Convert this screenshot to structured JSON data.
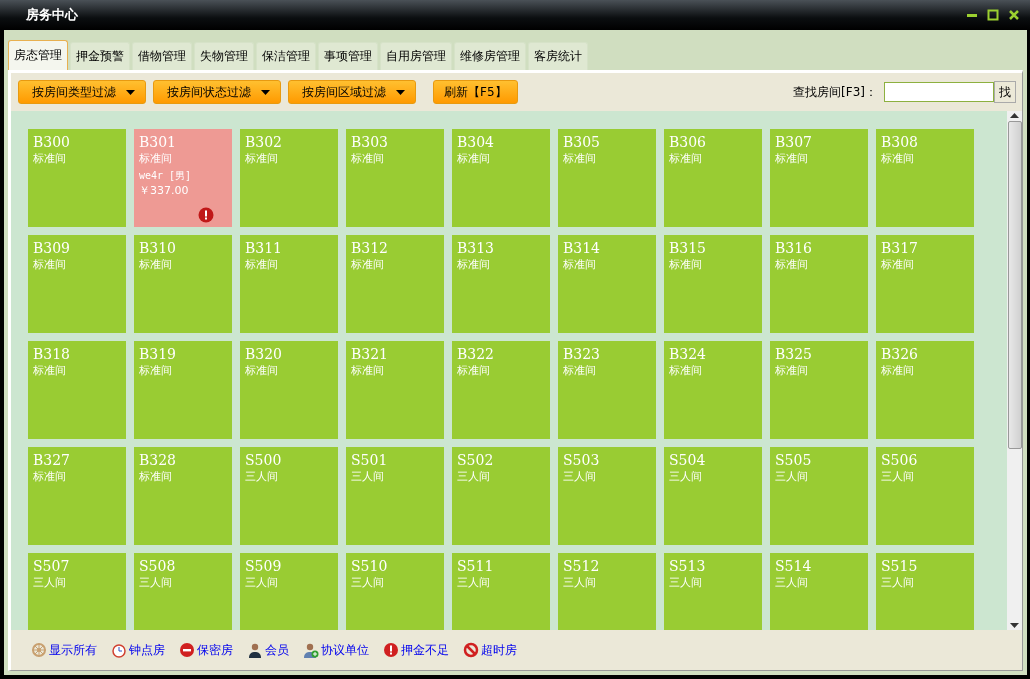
{
  "window": {
    "title": "房务中心"
  },
  "tabs": [
    {
      "label": "房态管理",
      "selected": true
    },
    {
      "label": "押金预警",
      "selected": false
    },
    {
      "label": "借物管理",
      "selected": false
    },
    {
      "label": "失物管理",
      "selected": false
    },
    {
      "label": "保洁管理",
      "selected": false
    },
    {
      "label": "事项管理",
      "selected": false
    },
    {
      "label": "自用房管理",
      "selected": false
    },
    {
      "label": "维修房管理",
      "selected": false
    },
    {
      "label": "客房统计",
      "selected": false
    }
  ],
  "filters": [
    "按房间类型过滤",
    "按房间状态过滤",
    "按房间区域过滤"
  ],
  "refresh_button": "刷新【F5】",
  "search": {
    "label": "查找房间[F3]：",
    "button": "找"
  },
  "rooms": [
    {
      "number": "B300",
      "type": "标准间",
      "color": "#99cc33"
    },
    {
      "number": "B301",
      "type": "标准间",
      "color": "#ee9a94",
      "guest": "we4r [男]",
      "price": "￥337.00",
      "alert": true
    },
    {
      "number": "B302",
      "type": "标准间",
      "color": "#99cc33"
    },
    {
      "number": "B303",
      "type": "标准间",
      "color": "#99cc33"
    },
    {
      "number": "B304",
      "type": "标准间",
      "color": "#99cc33"
    },
    {
      "number": "B305",
      "type": "标准间",
      "color": "#99cc33"
    },
    {
      "number": "B306",
      "type": "标准间",
      "color": "#99cc33"
    },
    {
      "number": "B307",
      "type": "标准间",
      "color": "#99cc33"
    },
    {
      "number": "B308",
      "type": "标准间",
      "color": "#99cc33"
    },
    {
      "number": "B309",
      "type": "标准间",
      "color": "#99cc33"
    },
    {
      "number": "B310",
      "type": "标准间",
      "color": "#99cc33"
    },
    {
      "number": "B311",
      "type": "标准间",
      "color": "#99cc33"
    },
    {
      "number": "B312",
      "type": "标准间",
      "color": "#99cc33"
    },
    {
      "number": "B313",
      "type": "标准间",
      "color": "#99cc33"
    },
    {
      "number": "B314",
      "type": "标准间",
      "color": "#99cc33"
    },
    {
      "number": "B315",
      "type": "标准间",
      "color": "#99cc33"
    },
    {
      "number": "B316",
      "type": "标准间",
      "color": "#99cc33"
    },
    {
      "number": "B317",
      "type": "标准间",
      "color": "#99cc33"
    },
    {
      "number": "B318",
      "type": "标准间",
      "color": "#99cc33"
    },
    {
      "number": "B319",
      "type": "标准间",
      "color": "#99cc33"
    },
    {
      "number": "B320",
      "type": "标准间",
      "color": "#99cc33"
    },
    {
      "number": "B321",
      "type": "标准间",
      "color": "#99cc33"
    },
    {
      "number": "B322",
      "type": "标准间",
      "color": "#99cc33"
    },
    {
      "number": "B323",
      "type": "标准间",
      "color": "#99cc33"
    },
    {
      "number": "B324",
      "type": "标准间",
      "color": "#99cc33"
    },
    {
      "number": "B325",
      "type": "标准间",
      "color": "#99cc33"
    },
    {
      "number": "B326",
      "type": "标准间",
      "color": "#99cc33"
    },
    {
      "number": "B327",
      "type": "标准间",
      "color": "#99cc33"
    },
    {
      "number": "B328",
      "type": "标准间",
      "color": "#99cc33"
    },
    {
      "number": "S500",
      "type": "三人间",
      "color": "#99cc33"
    },
    {
      "number": "S501",
      "type": "三人间",
      "color": "#99cc33"
    },
    {
      "number": "S502",
      "type": "三人间",
      "color": "#99cc33"
    },
    {
      "number": "S503",
      "type": "三人间",
      "color": "#99cc33"
    },
    {
      "number": "S504",
      "type": "三人间",
      "color": "#99cc33"
    },
    {
      "number": "S505",
      "type": "三人间",
      "color": "#99cc33"
    },
    {
      "number": "S506",
      "type": "三人间",
      "color": "#99cc33"
    },
    {
      "number": "S507",
      "type": "三人间",
      "color": "#99cc33"
    },
    {
      "number": "S508",
      "type": "三人间",
      "color": "#99cc33"
    },
    {
      "number": "S509",
      "type": "三人间",
      "color": "#99cc33"
    },
    {
      "number": "S510",
      "type": "三人间",
      "color": "#99cc33"
    },
    {
      "number": "S511",
      "type": "三人间",
      "color": "#99cc33"
    },
    {
      "number": "S512",
      "type": "三人间",
      "color": "#99cc33"
    },
    {
      "number": "S513",
      "type": "三人间",
      "color": "#99cc33"
    },
    {
      "number": "S514",
      "type": "三人间",
      "color": "#99cc33"
    },
    {
      "number": "S515",
      "type": "三人间",
      "color": "#99cc33"
    }
  ],
  "legend": [
    {
      "kind": "all",
      "label": "显示所有"
    },
    {
      "kind": "hourly",
      "label": "钟点房"
    },
    {
      "kind": "secret",
      "label": "保密房"
    },
    {
      "kind": "member",
      "label": "会员"
    },
    {
      "kind": "partner",
      "label": "协议单位"
    },
    {
      "kind": "deposit",
      "label": "押金不足"
    },
    {
      "kind": "overtime",
      "label": "超时房"
    }
  ]
}
